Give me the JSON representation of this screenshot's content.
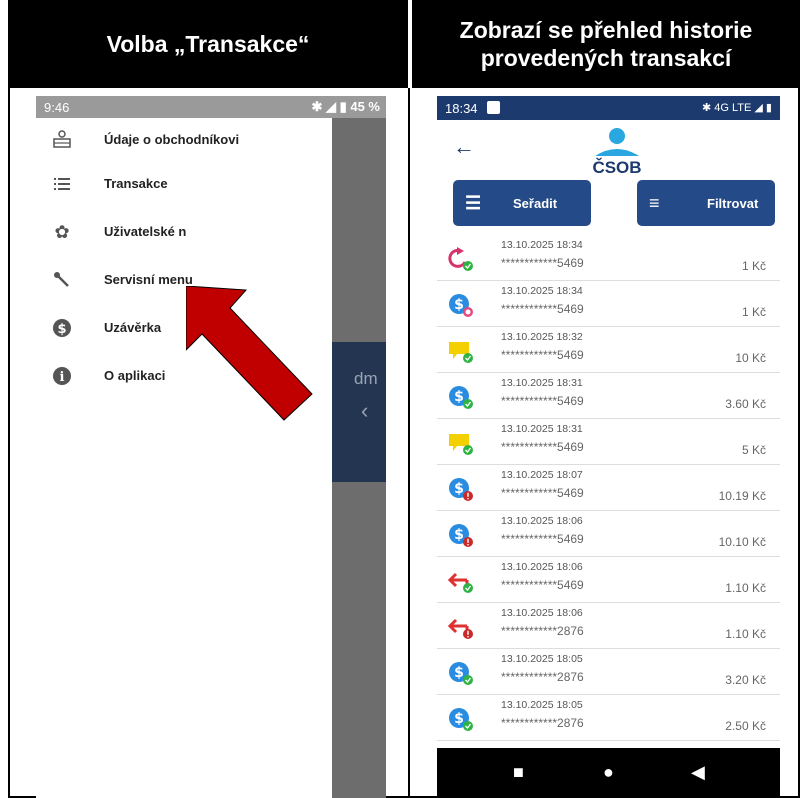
{
  "headers": {
    "left": "Volba „Transakce“",
    "right": "Zobrazí se přehled historie provedených transakcí"
  },
  "left_phone": {
    "status_time": "9:46",
    "status_battery": "45 %",
    "background_text": "dm",
    "menu": [
      {
        "label": "Údaje o obchodníkovi",
        "icon": "merchant-icon"
      },
      {
        "label": "Transakce",
        "icon": "list-icon"
      },
      {
        "label": "Uživatelské n",
        "icon": "gear-icon"
      },
      {
        "label": "Servisní menu",
        "icon": "wrench-icon"
      },
      {
        "label": "Uzávěrka",
        "icon": "dollar-icon"
      },
      {
        "label": "O aplikaci",
        "icon": "info-icon"
      }
    ],
    "arrow_color": "#c00000"
  },
  "right_phone": {
    "status_time": "18:34",
    "status_right": "✱ 4G LTE ◢ ▮",
    "logo_text": "ČSOB",
    "sort_label": "Seřadit",
    "filter_label": "Filtrovat",
    "accent": "#244a87",
    "transactions": [
      {
        "date": "13.10.2025 18:34",
        "card": "************5469",
        "amount": "1 Kč",
        "type": "refund",
        "status": "ok"
      },
      {
        "date": "13.10.2025 18:34",
        "card": "************5469",
        "amount": "1 Kč",
        "type": "sale",
        "status": "pending"
      },
      {
        "date": "13.10.2025 18:32",
        "card": "************5469",
        "amount": "10 Kč",
        "type": "voucher",
        "status": "ok"
      },
      {
        "date": "13.10.2025 18:31",
        "card": "************5469",
        "amount": "3.60 Kč",
        "type": "sale",
        "status": "ok"
      },
      {
        "date": "13.10.2025 18:31",
        "card": "************5469",
        "amount": "5 Kč",
        "type": "voucher",
        "status": "ok"
      },
      {
        "date": "13.10.2025 18:07",
        "card": "************5469",
        "amount": "10.19 Kč",
        "type": "sale",
        "status": "error"
      },
      {
        "date": "13.10.2025 18:06",
        "card": "************5469",
        "amount": "10.10 Kč",
        "type": "sale",
        "status": "error"
      },
      {
        "date": "13.10.2025 18:06",
        "card": "************5469",
        "amount": "1.10 Kč",
        "type": "return",
        "status": "ok"
      },
      {
        "date": "13.10.2025 18:06",
        "card": "************2876",
        "amount": "1.10 Kč",
        "type": "return",
        "status": "error"
      },
      {
        "date": "13.10.2025 18:05",
        "card": "************2876",
        "amount": "3.20 Kč",
        "type": "sale",
        "status": "ok"
      },
      {
        "date": "13.10.2025 18:05",
        "card": "************2876",
        "amount": "2.50 Kč",
        "type": "sale",
        "status": "ok"
      }
    ]
  }
}
